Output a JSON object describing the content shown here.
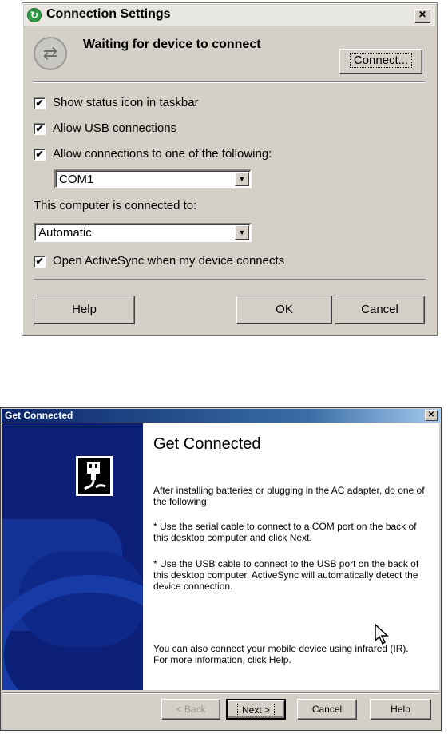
{
  "connection_settings": {
    "title": "Connection Settings",
    "status_text": "Waiting for device to connect",
    "connect_button": "Connect...",
    "show_status_icon": {
      "label": "Show status icon in taskbar",
      "checked": true
    },
    "allow_usb": {
      "label": "Allow USB connections",
      "checked": true
    },
    "allow_connections": {
      "label": "Allow connections to one of the following:",
      "checked": true
    },
    "port_select": {
      "value": "COM1"
    },
    "connected_to_label": "This computer is connected to:",
    "connected_to_select": {
      "value": "Automatic"
    },
    "open_activesync": {
      "label": "Open ActiveSync when my device connects",
      "checked": true
    },
    "buttons": {
      "help": "Help",
      "ok": "OK",
      "cancel": "Cancel"
    },
    "close_glyph": "✕",
    "icons": {
      "title": "activesync-icon",
      "status": "sync-arrows-icon"
    }
  },
  "get_connected": {
    "title": "Get Connected",
    "heading": "Get Connected",
    "paragraphs": [
      "After installing batteries or plugging in the AC adapter, do one of the following:",
      "* Use the serial cable to connect to a COM port on the back of this desktop computer and click Next.",
      "* Use the USB cable to connect to the USB port on the back of this desktop computer.  ActiveSync will automatically detect the device connection.",
      "You can also connect your mobile device using infrared (IR). For more information, click Help."
    ],
    "buttons": {
      "back": "< Back",
      "next": "Next >",
      "cancel": "Cancel",
      "help": "Help"
    },
    "close_glyph": "✕",
    "colors": {
      "sidebar": "#0b1f78",
      "titlebar": "#0a246a"
    }
  }
}
